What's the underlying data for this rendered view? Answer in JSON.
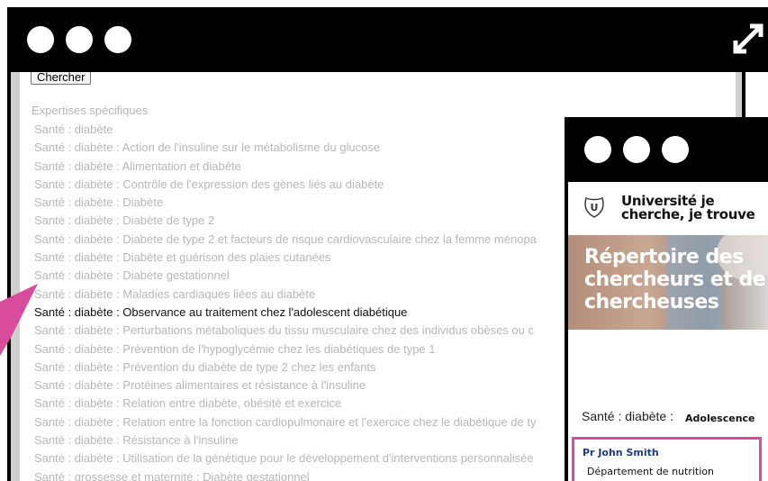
{
  "colors": {
    "window_chrome": "#000000",
    "window_dot": "#ffffff",
    "pointer_accent": "#d94b9b",
    "card_border": "#d94b9b",
    "researcher_link": "#1f3b7a",
    "muted_text": "#b7b7b7"
  },
  "main_window": {
    "titlebar": {
      "controls": [
        "circle",
        "circle",
        "circle"
      ],
      "expand_icon": "expand-diagonal-icon"
    },
    "search_button_label": "Chercher",
    "expertises_title": "Expertises spécifiques",
    "expertises": [
      "Santé : diabète",
      "Santé : diabète : Action de l'insuline sur le métabolisme du glucose",
      "Santé : diabète : Alimentation et diabète",
      "Santé : diabète : Contrôle de l'expression des gènes liés au diabète",
      "Santé : diabète : Diabète",
      "Santé : diabète : Diabète de type 2",
      "Santé : diabète : Diabète de type 2 et facteurs de risque cardiovasculaire chez la femme ménopa",
      "Santé : diabète : Diabète et guérison des plaies cutanées",
      "Santé : diabète : Diabète gestationnel",
      "Santé : diabète : Maladies cardiaques liées au diabète",
      "Santé : diabète : Observance au traitement chez l'adolescent diabétique",
      "Santé : diabète : Perturbations métaboliques du tissu musculaire chez des individus obèses ou c",
      "Santé : diabète : Prévention de l'hypoglycémie chez les diabétiques de type 1",
      "Santé : diabète : Prévention du diabète de type 2 chez les enfants",
      "Santé : diabète : Protéines alimentaires et résistance à l'insuline",
      "Santé : diabète : Relation entre diabète, obésité et exercice",
      "Santé : diabète : Relation entre la fonction cardiopulmonaire et l'exercice chez le diabétique de ty",
      "Santé : diabète : Résistance à l'insuline",
      "Santé : diabète : Utilisation de la génétique pour le développement d'interventions personnalisée",
      "Santé : grossesse et maternité : Diabète gestationnel"
    ]
  },
  "popup_window": {
    "titlebar": {
      "controls": [
        "circle",
        "circle",
        "circle"
      ]
    },
    "logo_icon": "university-crest-icon",
    "university_name": "Université je cherche, je trouve",
    "hero_title": "Répertoire des chercheurs et de chercheuses",
    "filter_prefix": "Santé : diabète :",
    "filter_value": "Adolescence",
    "result": {
      "name": "Pr John Smith",
      "department": "Département de nutrition"
    }
  }
}
